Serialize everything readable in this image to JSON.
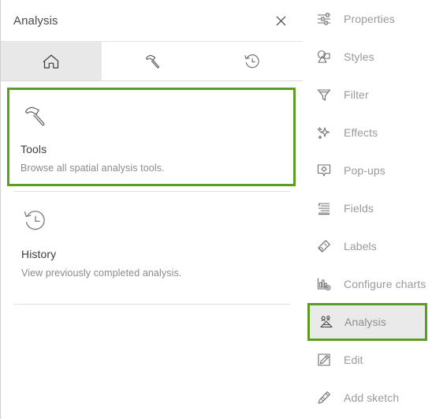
{
  "panel": {
    "title": "Analysis",
    "close_label": "Close",
    "close_icon": "close-icon",
    "tabs": [
      {
        "name": "home",
        "icon": "home-icon",
        "active": true
      },
      {
        "name": "tools",
        "icon": "hammer-icon",
        "active": false
      },
      {
        "name": "history",
        "icon": "history-icon",
        "active": false
      }
    ],
    "cards": [
      {
        "id": "tools",
        "icon": "hammer-icon",
        "title": "Tools",
        "description": "Browse all spatial analysis tools.",
        "selected": true
      },
      {
        "id": "history",
        "icon": "history-icon",
        "title": "History",
        "description": "View previously completed analysis.",
        "selected": false
      }
    ]
  },
  "sidebar": {
    "items": [
      {
        "label": "Properties",
        "icon": "sliders-icon",
        "selected": false
      },
      {
        "label": "Styles",
        "icon": "styles-icon",
        "selected": false
      },
      {
        "label": "Filter",
        "icon": "funnel-icon",
        "selected": false
      },
      {
        "label": "Effects",
        "icon": "sparkle-icon",
        "selected": false
      },
      {
        "label": "Pop-ups",
        "icon": "popup-icon",
        "selected": false
      },
      {
        "label": "Fields",
        "icon": "fields-icon",
        "selected": false
      },
      {
        "label": "Labels",
        "icon": "label-tag-icon",
        "selected": false
      },
      {
        "label": "Configure charts",
        "icon": "chart-gear-icon",
        "selected": false
      },
      {
        "label": "Analysis",
        "icon": "analysis-icon",
        "selected": true
      },
      {
        "label": "Edit",
        "icon": "pencil-square-icon",
        "selected": false
      },
      {
        "label": "Add sketch",
        "icon": "sketch-pencil-icon",
        "selected": false
      }
    ]
  },
  "colors": {
    "highlight_green": "#5b9c22",
    "selected_gray": "#eaeaea",
    "active_tab_gray": "#e8e8e8",
    "text_dark": "#3c3c3c",
    "text_muted": "#9a9a9a"
  }
}
